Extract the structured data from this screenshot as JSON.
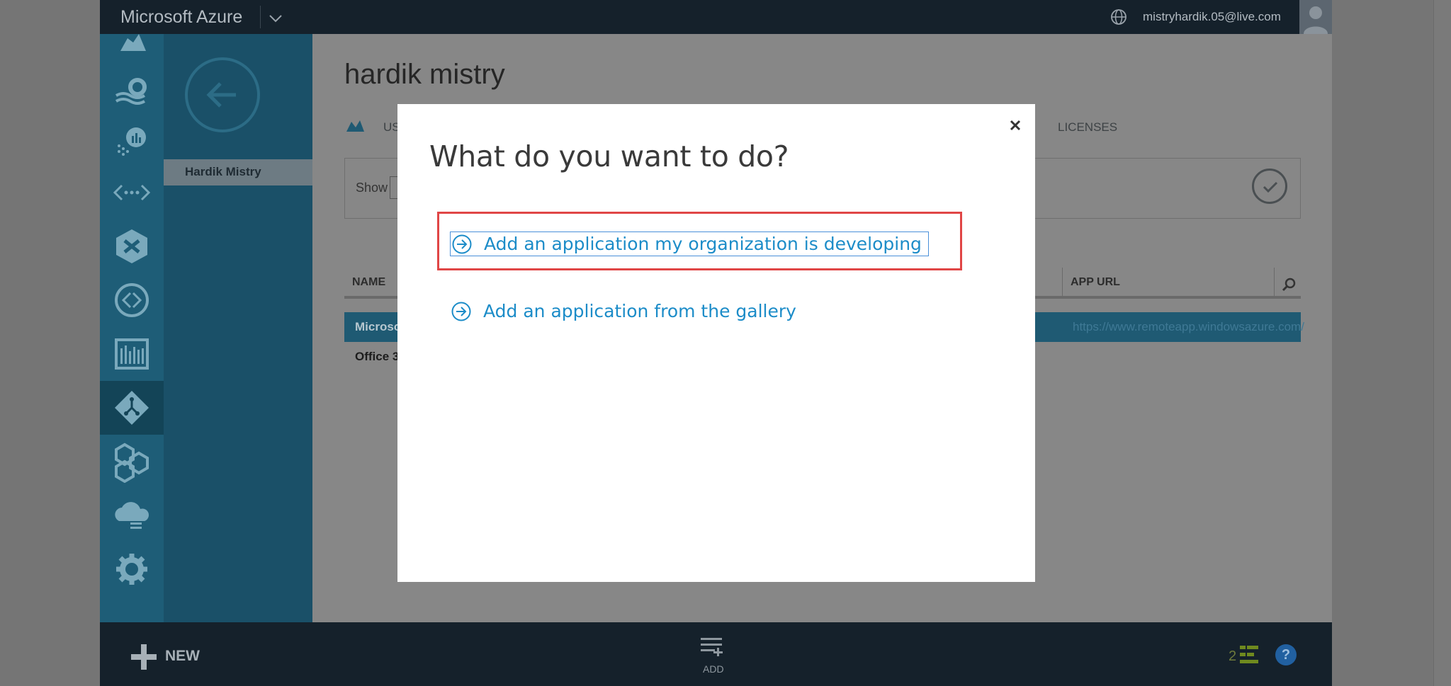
{
  "topbar": {
    "brand": "Microsoft Azure",
    "user_email": "mistryhardik.05@live.com"
  },
  "rail": {
    "items": [
      {
        "icon": "cloud-icon"
      },
      {
        "icon": "gear-services-icon"
      },
      {
        "icon": "hdinsight-icon"
      },
      {
        "icon": "machine-learning-icon"
      },
      {
        "icon": "api-icon"
      },
      {
        "icon": "biztalk-icon"
      },
      {
        "icon": "networks-icon"
      },
      {
        "icon": "traffic-manager-icon"
      },
      {
        "icon": "active-directory-icon",
        "active": true
      },
      {
        "icon": "marketplace-icon"
      },
      {
        "icon": "cloud-services-icon"
      },
      {
        "icon": "settings-icon"
      }
    ]
  },
  "subnav": {
    "selected_item": "Hardik Mistry"
  },
  "main": {
    "page_title": "hardik mistry",
    "tab_users_partial": "US",
    "tab_licenses": "LICENSES",
    "filter_show_label": "Show",
    "table": {
      "col_name": "NAME",
      "col_app_url": "APP URL",
      "rows": [
        {
          "name": "Microso",
          "url": "https://www.remoteapp.windowsazure.com/",
          "selected": true
        },
        {
          "name": "Office 3",
          "url": ""
        }
      ]
    }
  },
  "bottombar": {
    "new_label": "NEW",
    "add_label": "ADD",
    "progress_count": "2",
    "help_label": "?"
  },
  "modal": {
    "title": "What do you want to do?",
    "options": [
      {
        "label": "Add an application my organization is developing",
        "focused": true
      },
      {
        "label": "Add an application from the gallery"
      }
    ]
  },
  "colors": {
    "accent_link": "#1c8cc8",
    "highlight_border": "#e04646",
    "topbar": "#15212b",
    "rail": "#1e5d77"
  }
}
